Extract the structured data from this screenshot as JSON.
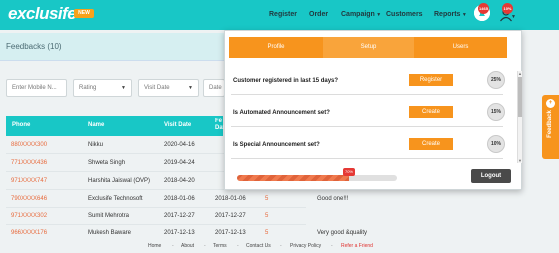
{
  "header": {
    "logo": "exclusife",
    "new_badge": "NEW",
    "nav": {
      "register": "Register",
      "order": "Order",
      "campaign": "Campaign",
      "customers": "Customers",
      "reports": "Reports"
    },
    "notification_count": "1465",
    "profile_percent": "10%"
  },
  "page": {
    "title": "Feedbacks (10)"
  },
  "filters": {
    "mobile_placeholder": "Enter Mobile N...",
    "rating": "Rating",
    "visit_date": "Visit Date",
    "date": "Date"
  },
  "table": {
    "headers": {
      "phone": "Phone",
      "name": "Name",
      "visit_date": "Visit Date",
      "fe": "Fe Date"
    },
    "rows": [
      {
        "phone": "880XXXX300",
        "name": "Nikku",
        "visit_date": "2020-04-16",
        "feedback_date": "",
        "rating": "",
        "comment": ""
      },
      {
        "phone": "771XXXX436",
        "name": "Shweta Singh",
        "visit_date": "2019-04-24",
        "feedback_date": "",
        "rating": "",
        "comment": ""
      },
      {
        "phone": "971XXXX747",
        "name": "Harshita Jaiswal (OVP)",
        "visit_date": "2018-04-20",
        "feedback_date": "",
        "rating": "",
        "comment": ""
      },
      {
        "phone": "790XXXX646",
        "name": "Exclusife Technosoft",
        "visit_date": "2018-01-06",
        "feedback_date": "2018-01-06",
        "rating": "5",
        "comment": "Good one!!!"
      },
      {
        "phone": "971XXXX302",
        "name": "Sumit Mehrotra",
        "visit_date": "2017-12-27",
        "feedback_date": "2017-12-27",
        "rating": "5",
        "comment": ""
      },
      {
        "phone": "966XXXX176",
        "name": "Mukesh Baware",
        "visit_date": "2017-12-13",
        "feedback_date": "2017-12-13",
        "rating": "5",
        "comment": "Very good &quality"
      }
    ]
  },
  "popup": {
    "tabs": [
      "Profile",
      "Setup",
      "Users"
    ],
    "active_tab": "Setup",
    "questions": [
      {
        "text": "Customer registered in last 15 days?",
        "button": "Register",
        "percent": "25%"
      },
      {
        "text": "Is Automated Announcement set?",
        "button": "Create",
        "percent": "15%"
      },
      {
        "text": "Is Special Announcement set?",
        "button": "Create",
        "percent": "10%"
      }
    ],
    "progress_percent": 70,
    "progress_label": "70%",
    "logout": "Logout"
  },
  "feedback_tab": {
    "label": "Feedback",
    "icon": "+"
  },
  "footer": {
    "links": [
      "Home",
      "About",
      "Terms",
      "Contact Us",
      "Privacy Policy",
      "Refer a Friend"
    ]
  },
  "colors": {
    "teal": "#18c7c6",
    "orange": "#f7941d",
    "link_orange": "#e86a3c"
  }
}
